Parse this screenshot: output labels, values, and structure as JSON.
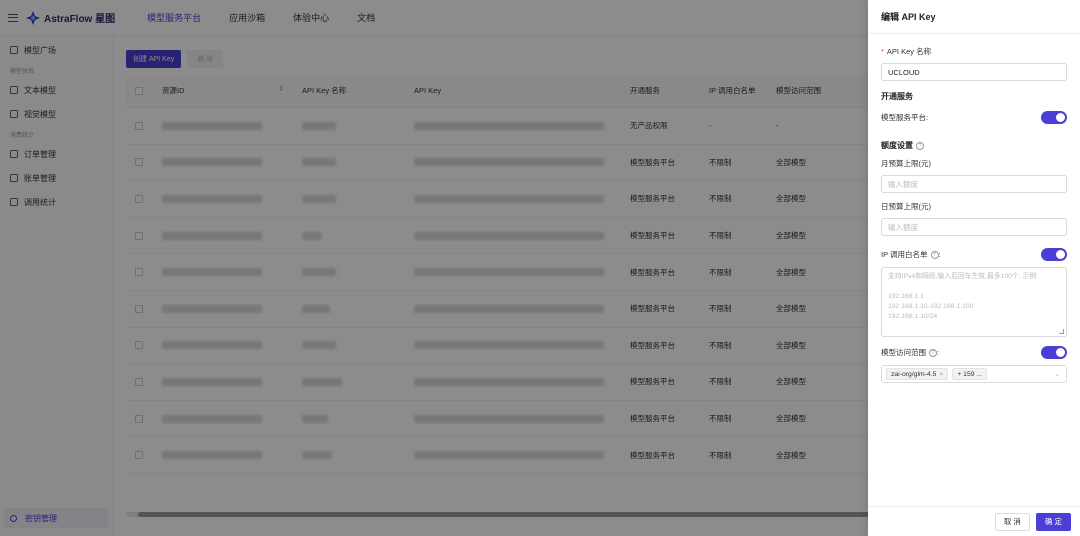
{
  "app": {
    "logo_text": "AstraFlow 星图",
    "nav": [
      {
        "label": "模型服务平台"
      },
      {
        "label": "应用沙箱"
      },
      {
        "label": "体验中心"
      },
      {
        "label": "文档"
      }
    ]
  },
  "sidebar": {
    "items": [
      {
        "label": "模型广场"
      },
      {
        "group": "模型体验"
      },
      {
        "label": "文本模型"
      },
      {
        "label": "视觉模型"
      },
      {
        "group": "消费统计"
      },
      {
        "label": "订单管理"
      },
      {
        "label": "账单管理"
      },
      {
        "label": "调用统计"
      }
    ],
    "active_label": "密钥管理"
  },
  "toolbar": {
    "create_label": "创建 API Key",
    "delete_label": "删 除"
  },
  "table": {
    "headers": [
      "资源ID",
      "API Key 名称",
      "API Key",
      "开通服务",
      "IP 调用白名单",
      "模型访问范围"
    ],
    "rows": [
      {
        "service": "无产品权限",
        "ip": "-",
        "scope": "-"
      },
      {
        "service": "模型服务平台",
        "ip": "不限制",
        "scope": "全部模型"
      },
      {
        "service": "模型服务平台",
        "ip": "不限制",
        "scope": "全部模型"
      },
      {
        "service": "模型服务平台",
        "ip": "不限制",
        "scope": "全部模型"
      },
      {
        "service": "模型服务平台",
        "ip": "不限制",
        "scope": "全部模型"
      },
      {
        "service": "模型服务平台",
        "ip": "不限制",
        "scope": "全部模型"
      },
      {
        "service": "模型服务平台",
        "ip": "不限制",
        "scope": "全部模型"
      },
      {
        "service": "模型服务平台",
        "ip": "不限制",
        "scope": "全部模型"
      },
      {
        "service": "模型服务平台",
        "ip": "不限制",
        "scope": "全部模型"
      },
      {
        "service": "模型服务平台",
        "ip": "不限制",
        "scope": "全部模型"
      }
    ]
  },
  "drawer": {
    "title": "编辑 API Key",
    "name_label": "API Key 名称",
    "name_value": "UCLOUD",
    "service_section": "开通服务",
    "service_label": "模型服务平台:",
    "service_enabled": true,
    "quota_section": "额度设置",
    "monthly_label": "月预算上限(元)",
    "monthly_placeholder": "输入额度",
    "daily_label": "日预算上限(元)",
    "daily_placeholder": "输入额度",
    "ip_label": "IP 调用白名单",
    "ip_enabled": true,
    "ip_placeholder_line1": "支持IPv4和网段,输入后回车生效,最多100个, 示例:",
    "ip_placeholder_examples": [
      "192.168.1.1",
      "192.168.1.10-192.168.1.100",
      "192.168.1.10/24"
    ],
    "scope_label": "模型访问范围",
    "scope_enabled": true,
    "scope_tag": "zai-org/glm-4.5",
    "scope_more": "+ 159 ...",
    "cancel_label": "取 消",
    "ok_label": "确 定"
  },
  "colors": {
    "accent": "#4a3fd6",
    "danger": "#e5484d"
  }
}
